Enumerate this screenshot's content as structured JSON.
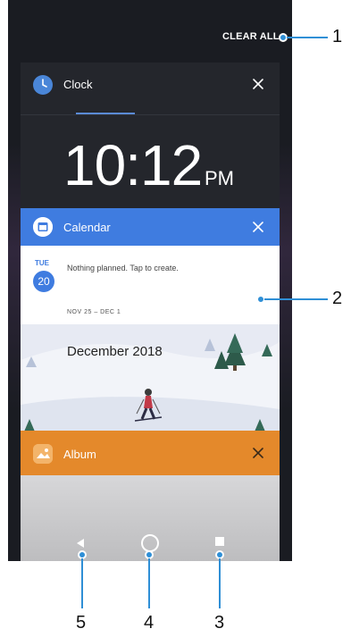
{
  "header": {
    "clear_all": "CLEAR ALL"
  },
  "cards": {
    "clock": {
      "title": "Clock",
      "time": "10:12",
      "ampm": "PM"
    },
    "calendar": {
      "title": "Calendar",
      "day_name": "TUE",
      "day_number": "20",
      "nothing_planned": "Nothing planned. Tap to create.",
      "date_range": "NOV 25 – DEC 1",
      "month": "December 2018"
    },
    "album": {
      "title": "Album"
    }
  },
  "callouts": [
    "1",
    "2",
    "3",
    "4",
    "5"
  ],
  "icons": {
    "clock": "clock-icon",
    "calendar": "calendar-icon",
    "album": "album-icon",
    "close": "close-icon",
    "back": "back-icon",
    "home": "home-icon",
    "recent": "recent-apps-icon"
  },
  "colors": {
    "accent": "#3f7ce0",
    "album": "#e4892b",
    "callout": "#2f8fd6"
  }
}
